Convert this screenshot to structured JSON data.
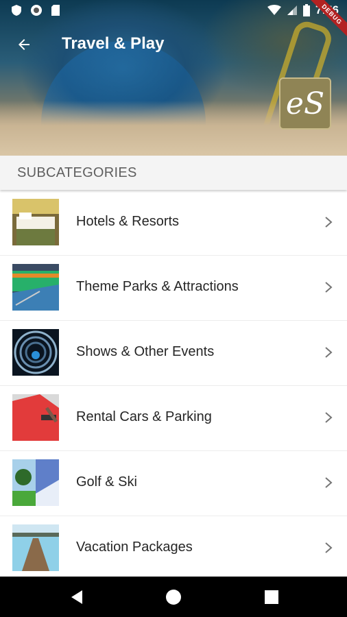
{
  "status_bar": {
    "time": "7:56",
    "debug_label": "DEBUG"
  },
  "header": {
    "title": "Travel & Play",
    "logo_text": "eS"
  },
  "subheader": {
    "label": "SUBCATEGORIES"
  },
  "subcategories": [
    {
      "label": "Hotels & Resorts"
    },
    {
      "label": "Theme Parks & Attractions"
    },
    {
      "label": "Shows & Other Events"
    },
    {
      "label": "Rental Cars & Parking"
    },
    {
      "label": "Golf & Ski"
    },
    {
      "label": "Vacation Packages"
    }
  ],
  "icons": {
    "back": "arrow-back-icon",
    "chevron": "chevron-right-icon"
  },
  "colors": {
    "accent": "#8f8455",
    "debug": "#b22222"
  }
}
